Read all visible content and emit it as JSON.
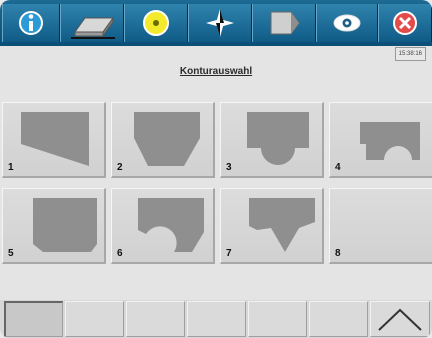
{
  "toolbar": {
    "icons": [
      "info-icon",
      "eraser-icon",
      "spindle-icon",
      "compass-icon",
      "play-icon",
      "eye-icon",
      "close-icon"
    ],
    "clock": "15:38:16"
  },
  "page": {
    "title": "Konturauswahl"
  },
  "contours": [
    {
      "number": "1"
    },
    {
      "number": "2"
    },
    {
      "number": "3"
    },
    {
      "number": "4"
    },
    {
      "number": "5"
    },
    {
      "number": "6"
    },
    {
      "number": "7"
    },
    {
      "number": "8"
    }
  ],
  "bottom": {
    "arrow_icon": "chevron-up-icon"
  }
}
